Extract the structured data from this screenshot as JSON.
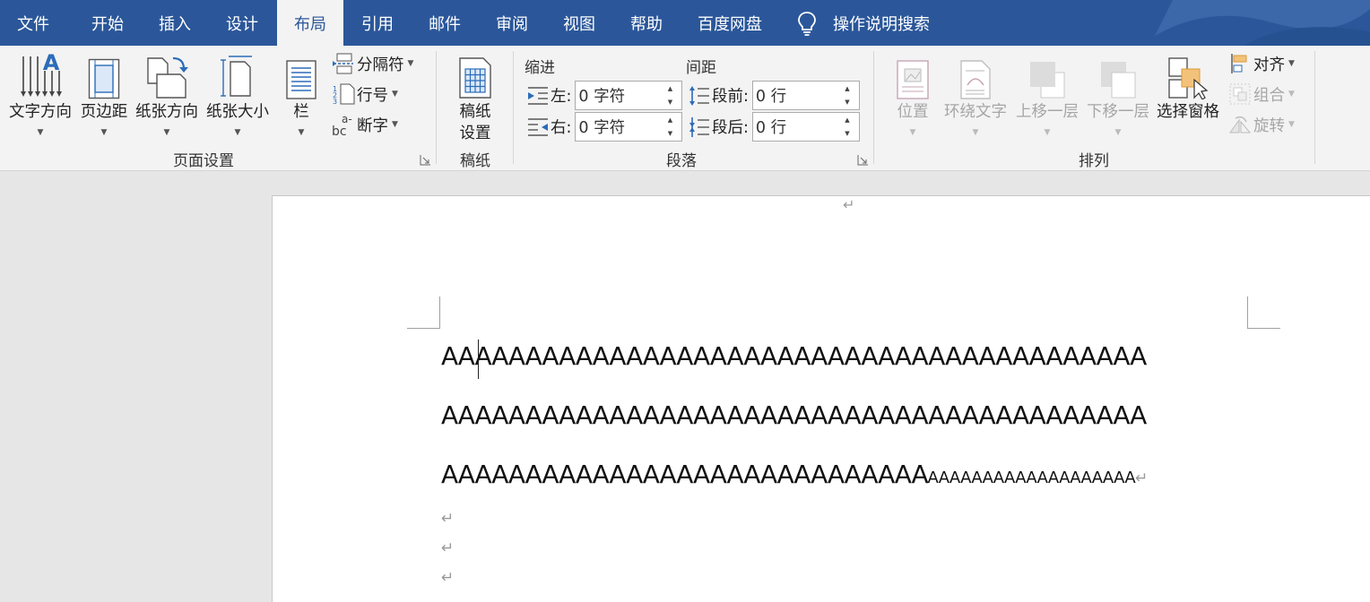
{
  "tabs": [
    {
      "label": "文件",
      "active": false
    },
    {
      "label": "开始",
      "active": false
    },
    {
      "label": "插入",
      "active": false
    },
    {
      "label": "设计",
      "active": false
    },
    {
      "label": "布局",
      "active": true
    },
    {
      "label": "引用",
      "active": false
    },
    {
      "label": "邮件",
      "active": false
    },
    {
      "label": "审阅",
      "active": false
    },
    {
      "label": "视图",
      "active": false
    },
    {
      "label": "帮助",
      "active": false
    },
    {
      "label": "百度网盘",
      "active": false
    }
  ],
  "tell_me": {
    "label": "操作说明搜索",
    "icon": "lightbulb-icon"
  },
  "page_setup": {
    "group_label": "页面设置",
    "text_direction": "文字方向",
    "margins": "页边距",
    "orientation": "纸张方向",
    "size": "纸张大小",
    "columns": "栏",
    "breaks": "分隔符",
    "line_numbers": "行号",
    "hyphenation": "断字"
  },
  "manuscript": {
    "group_label": "稿纸",
    "button_line1": "稿纸",
    "button_line2": "设置"
  },
  "paragraph": {
    "group_label": "段落",
    "indent_title": "缩进",
    "spacing_title": "间距",
    "left_label": "左:",
    "left_value": "0 字符",
    "right_label": "右:",
    "right_value": "0 字符",
    "before_label": "段前:",
    "before_value": "0 行",
    "after_label": "段后:",
    "after_value": "0 行"
  },
  "arrange": {
    "group_label": "排列",
    "position": "位置",
    "wrap_text": "环绕文字",
    "bring_forward": "上移一层",
    "send_backward": "下移一层",
    "selection_pane": "选择窗格",
    "align": "对齐",
    "group": "组合",
    "rotate": "旋转"
  },
  "document": {
    "top_mark": "↵",
    "line1": "AAAAAAAAAAAAAAAAAAAAAAAAAAAAAAAAAAAAAAAAAA",
    "line2": "AAAAAAAAAAAAAAAAAAAAAAAAAAAAAAAAAAAAAAAAAA",
    "line3_large": "AAAAAAAAAAAAAAAAAAAAAAAAAAAAA",
    "line3_small": "AAAAAAAAAAAAAAAAAAA",
    "para_mark": "↵"
  },
  "colors": {
    "accent": "#2b579a",
    "ribbon": "#f3f3f3",
    "canvas": "#e6e6e6"
  }
}
